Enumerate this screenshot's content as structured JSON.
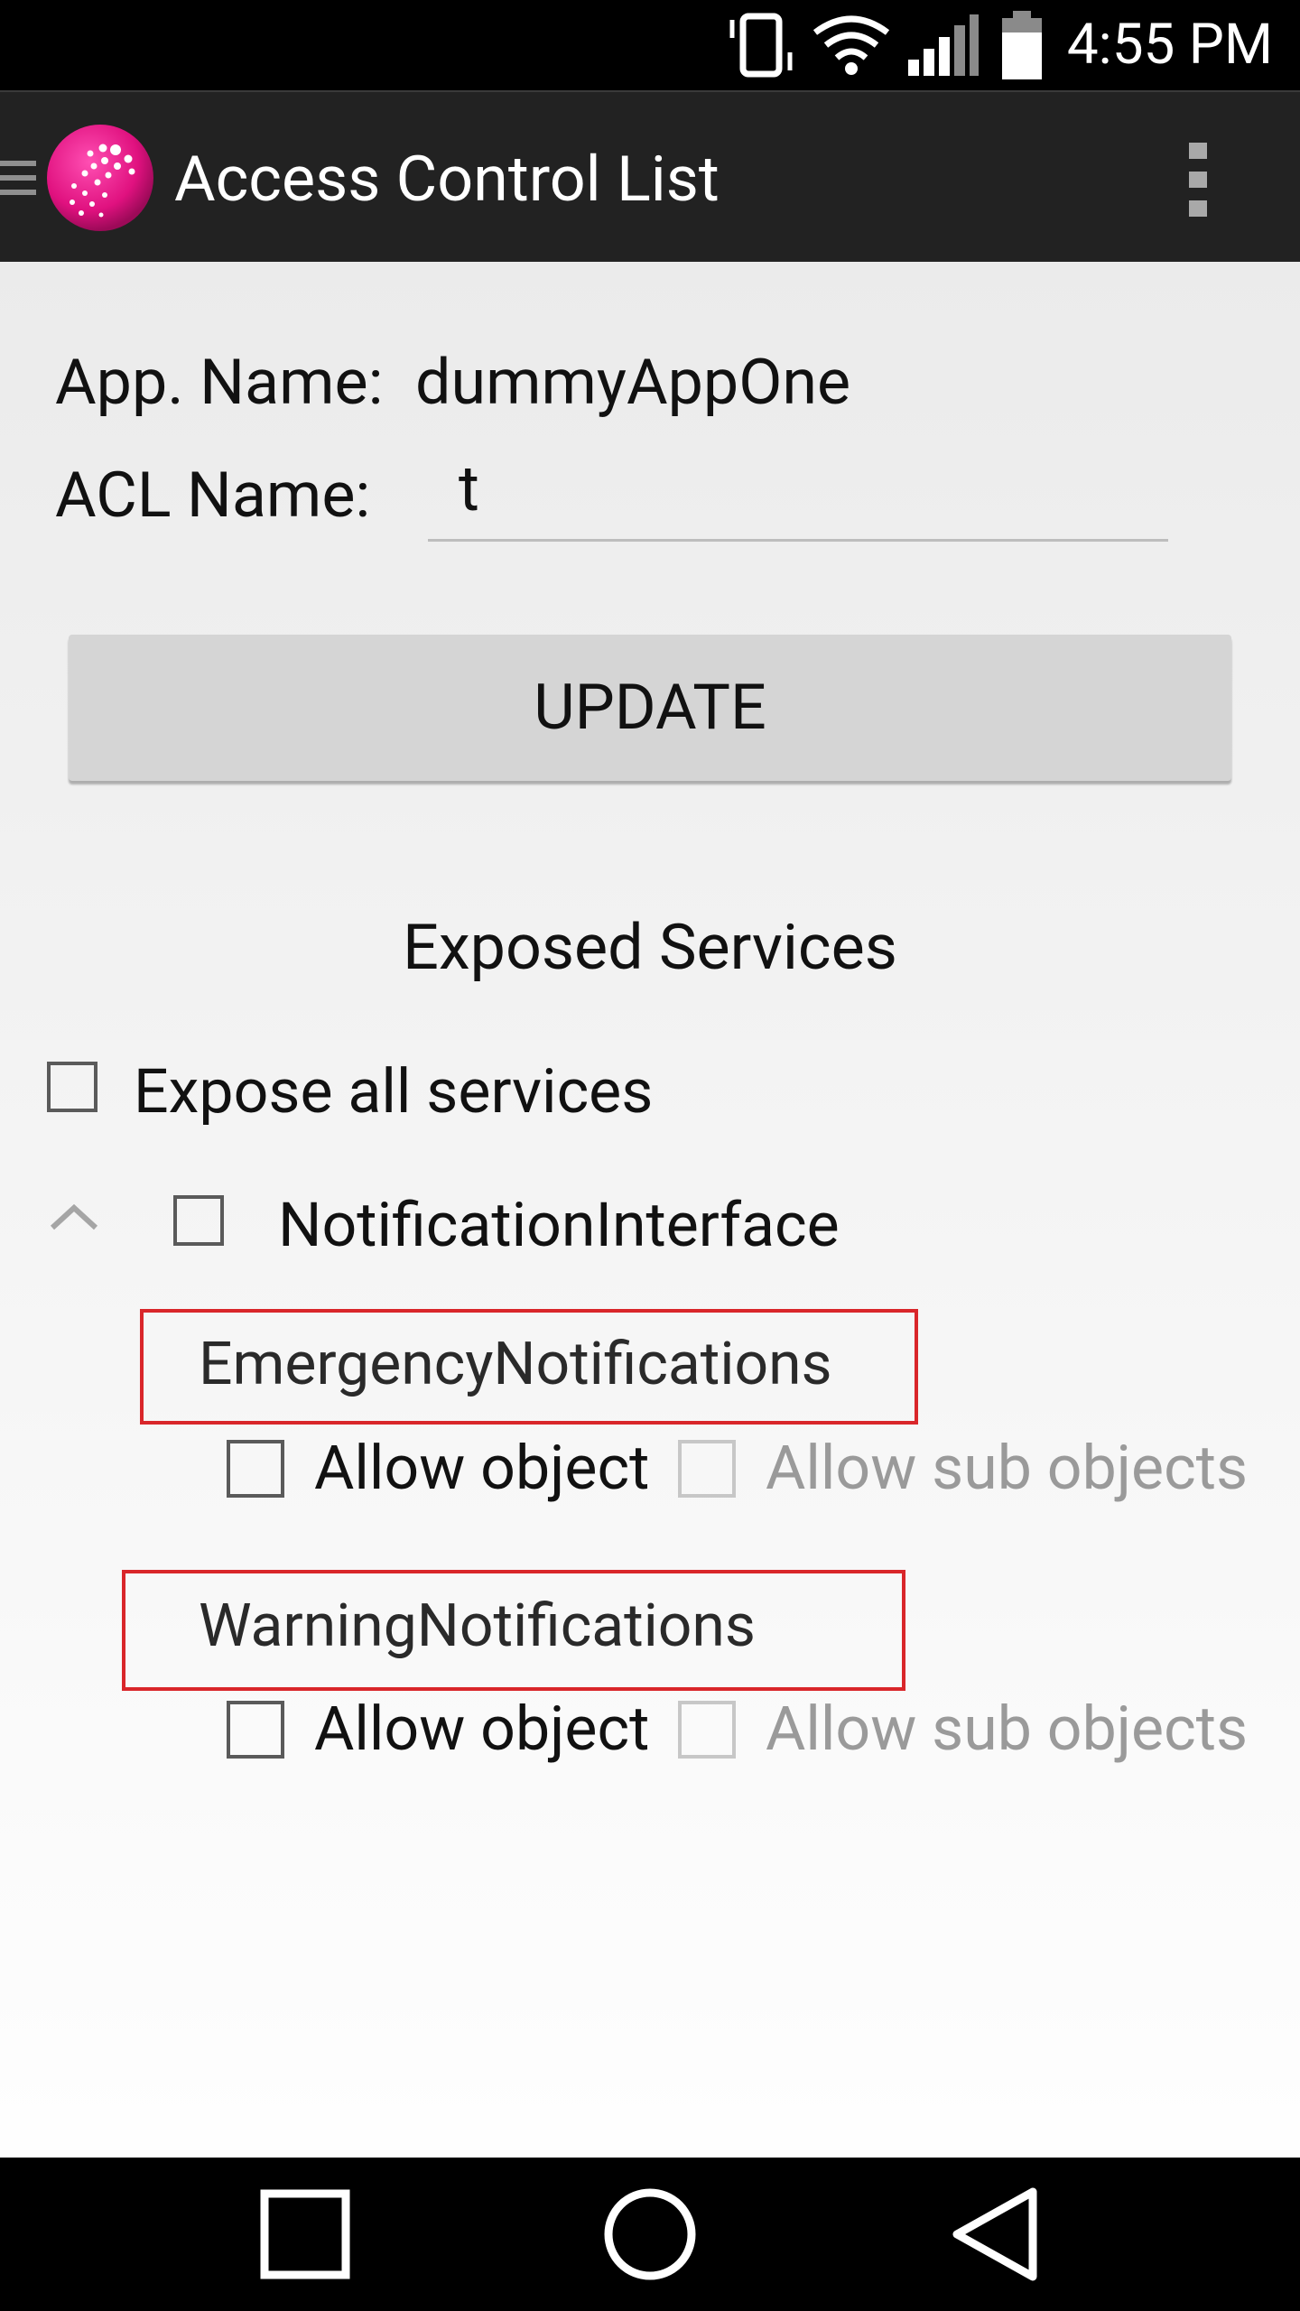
{
  "status_bar": {
    "time": "4:55 PM",
    "icons": [
      "vibrate-icon",
      "wifi-icon",
      "signal-icon",
      "battery-icon"
    ]
  },
  "action_bar": {
    "title": "Access Control List",
    "icons": [
      "menu-icon",
      "app-logo-icon",
      "overflow-menu-icon"
    ]
  },
  "form": {
    "app_name_label": "App. Name:",
    "app_name_value": "dummyAppOne",
    "acl_name_label": "ACL Name:",
    "acl_name_value": "t",
    "update_label": "UPDATE"
  },
  "services": {
    "title": "Exposed Services",
    "expose_all_label": "Expose all services",
    "expose_all_checked": false,
    "interface": {
      "name": "NotificationInterface",
      "checked": false,
      "expanded": true,
      "objects": [
        {
          "name": "EmergencyNotifications",
          "allow_object_label": "Allow object",
          "allow_object_checked": false,
          "allow_sub_objects_label": "Allow sub objects",
          "allow_sub_objects_enabled": false
        },
        {
          "name": "WarningNotifications",
          "allow_object_label": "Allow object",
          "allow_object_checked": false,
          "allow_sub_objects_label": "Allow sub objects",
          "allow_sub_objects_enabled": false
        }
      ]
    }
  },
  "highlight_color": "#d9262a",
  "accent_color": "#e0117f",
  "nav_bar": {
    "buttons": [
      "recents-icon",
      "home-icon",
      "back-icon"
    ]
  }
}
